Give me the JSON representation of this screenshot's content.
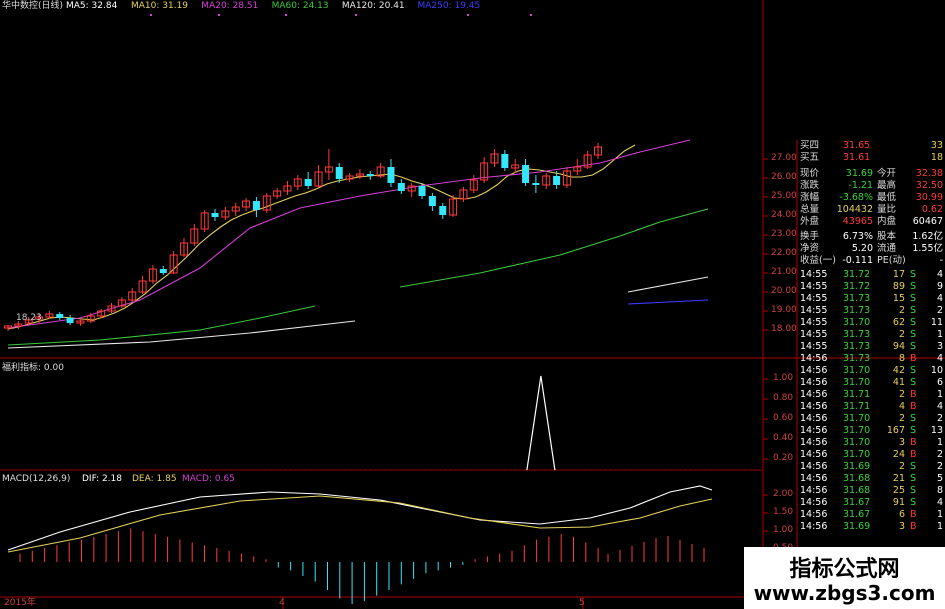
{
  "header": {
    "title": "华中数控(日线)",
    "ma": [
      {
        "label": "MA5: 32.84",
        "color": "#ffffff"
      },
      {
        "label": "MA10: 31.19",
        "color": "#e6d15a"
      },
      {
        "label": "MA20: 28.51",
        "color": "#d43fd4"
      },
      {
        "label": "MA60: 24.13",
        "color": "#3ac83a"
      },
      {
        "label": "MA120: 20.41",
        "color": "#e8e8e8"
      },
      {
        "label": "MA250: 19.45",
        "color": "#3b3bff"
      }
    ]
  },
  "colors": {
    "up": "#ff3b3b",
    "down": "#35e6ff",
    "axis": "#b00000",
    "grid": "#7a0000"
  },
  "price_axis": {
    "labels": [
      "27.00",
      "26.00",
      "25.00",
      "24.00",
      "23.00",
      "22.00",
      "21.00",
      "20.00",
      "19.00",
      "18.00"
    ]
  },
  "indicator": {
    "title": "福利指标: 0.00",
    "axis_labels": [
      "1.00",
      "0.80",
      "0.60",
      "0.40",
      "0.20"
    ]
  },
  "macd": {
    "title": "MACD(12,26,9)",
    "dif": "DIF: 2.18",
    "dea": "DEA: 1.85",
    "macd": "MACD: 0.65",
    "axis_labels": [
      "2.00",
      "1.50",
      "1.00",
      "0.50"
    ]
  },
  "date_axis": {
    "labels": [
      "2015年",
      "4",
      "5"
    ]
  },
  "price_note": "18.23",
  "chart_data": {
    "type": "candlestick",
    "candles": [
      [
        18.35,
        18.45,
        18.2,
        18.5
      ],
      [
        18.45,
        18.55,
        18.3,
        18.7
      ],
      [
        18.6,
        18.75,
        18.5,
        18.9
      ],
      [
        18.8,
        18.9,
        18.6,
        19.1
      ],
      [
        18.9,
        19.05,
        18.8,
        19.2
      ],
      [
        19.05,
        18.85,
        18.75,
        19.15
      ],
      [
        18.85,
        18.6,
        18.5,
        19.0
      ],
      [
        18.6,
        18.7,
        18.45,
        18.85
      ],
      [
        18.7,
        18.95,
        18.6,
        19.1
      ],
      [
        18.95,
        19.2,
        18.85,
        19.3
      ],
      [
        19.2,
        19.45,
        19.1,
        19.6
      ],
      [
        19.45,
        19.75,
        19.35,
        19.9
      ],
      [
        19.75,
        20.15,
        19.65,
        20.35
      ],
      [
        20.15,
        20.7,
        20.05,
        20.95
      ],
      [
        20.7,
        21.3,
        20.55,
        21.5
      ],
      [
        21.3,
        21.1,
        21.0,
        21.45
      ],
      [
        21.1,
        22.0,
        21.05,
        22.2
      ],
      [
        22.0,
        22.6,
        21.9,
        22.85
      ],
      [
        22.6,
        23.3,
        22.45,
        23.55
      ],
      [
        23.3,
        24.1,
        23.15,
        24.25
      ],
      [
        24.1,
        23.9,
        23.7,
        24.3
      ],
      [
        23.9,
        24.2,
        23.75,
        24.4
      ],
      [
        24.2,
        24.4,
        23.95,
        24.6
      ],
      [
        24.4,
        24.7,
        24.2,
        24.85
      ],
      [
        24.7,
        24.25,
        23.9,
        24.9
      ],
      [
        24.25,
        24.95,
        24.1,
        25.1
      ],
      [
        24.95,
        25.2,
        24.8,
        25.35
      ],
      [
        25.2,
        25.45,
        25.0,
        25.7
      ],
      [
        25.45,
        25.8,
        25.25,
        26.0
      ],
      [
        25.8,
        25.45,
        25.3,
        26.15
      ],
      [
        25.45,
        26.15,
        25.35,
        26.5
      ],
      [
        26.15,
        26.4,
        25.75,
        27.3
      ],
      [
        26.4,
        25.8,
        25.6,
        26.6
      ],
      [
        25.8,
        25.95,
        25.65,
        26.1
      ],
      [
        25.95,
        26.05,
        25.8,
        26.3
      ],
      [
        26.05,
        25.95,
        25.75,
        26.2
      ],
      [
        25.95,
        26.4,
        25.85,
        26.6
      ],
      [
        26.4,
        25.6,
        25.4,
        26.8
      ],
      [
        25.6,
        25.2,
        25.05,
        25.8
      ],
      [
        25.2,
        25.45,
        24.9,
        25.6
      ],
      [
        25.45,
        24.95,
        24.8,
        25.6
      ],
      [
        24.95,
        24.45,
        24.2,
        25.1
      ],
      [
        24.45,
        24.0,
        23.8,
        24.6
      ],
      [
        24.0,
        24.8,
        23.9,
        25.0
      ],
      [
        24.8,
        25.25,
        24.65,
        25.4
      ],
      [
        25.25,
        25.75,
        25.1,
        26.0
      ],
      [
        25.75,
        26.6,
        25.6,
        26.9
      ],
      [
        26.6,
        27.05,
        26.4,
        27.3
      ],
      [
        27.05,
        26.35,
        26.2,
        27.25
      ],
      [
        26.35,
        26.5,
        26.1,
        26.8
      ],
      [
        26.5,
        25.6,
        25.45,
        26.8
      ],
      [
        25.6,
        25.5,
        25.1,
        26.0
      ],
      [
        25.5,
        25.95,
        25.3,
        26.1
      ],
      [
        25.95,
        25.5,
        25.3,
        26.2
      ],
      [
        25.5,
        26.2,
        25.35,
        26.4
      ],
      [
        26.2,
        26.4,
        26.0,
        26.8
      ],
      [
        26.4,
        27.0,
        26.3,
        27.2
      ],
      [
        27.0,
        27.4,
        26.8,
        27.6
      ]
    ],
    "dates_shown": [
      "2015年",
      "4",
      "5"
    ],
    "ma_lines": {
      "MA5": [
        18.3,
        18.4,
        18.55,
        18.7,
        18.85,
        18.9,
        18.85,
        18.8,
        18.75,
        18.9,
        19.1,
        19.35,
        19.7,
        20.1,
        20.6,
        21.0,
        21.5,
        22.0,
        22.55,
        23.0,
        23.4,
        23.75,
        24.0,
        24.2,
        24.35,
        24.55,
        24.75,
        24.95,
        25.1,
        25.3,
        25.55,
        25.7,
        25.8,
        25.9,
        25.95,
        26.0,
        26.05,
        25.9,
        25.7,
        25.55,
        25.35,
        25.1,
        24.85,
        24.8,
        24.9,
        25.15,
        25.5,
        25.95,
        26.2,
        26.3,
        26.25,
        26.15,
        26.05,
        25.9,
        25.9,
        26.0,
        26.3,
        26.75,
        27.2,
        27.5
      ]
    },
    "price_range": [
      17.5,
      28.0
    ],
    "indicator": {
      "title": "福利指标",
      "value": 0.0,
      "spike_index": 51,
      "spike_value": 1.0
    },
    "macd": {
      "dif": 2.18,
      "dea": 1.85,
      "macd": 0.65
    }
  },
  "quote": {
    "levels": [
      {
        "label": "买四",
        "price": "31.65",
        "vol": "33"
      },
      {
        "label": "买五",
        "price": "31.61",
        "vol": "18"
      }
    ],
    "stats": [
      {
        "l1": "现价",
        "v1": "31.69",
        "l2": "今开",
        "v2": "32.38",
        "c1": "#3ad43a"
      },
      {
        "l1": "涨跌",
        "v1": "-1.21",
        "l2": "最高",
        "v2": "32.50",
        "c1": "#3ad43a"
      },
      {
        "l1": "涨幅",
        "v1": "-3.68%",
        "l2": "最低",
        "v2": "30.99",
        "c1": "#3ad43a"
      },
      {
        "l1": "总量",
        "v1": "104432",
        "l2": "量比",
        "v2": "0.62",
        "c1": "#e6d15a"
      },
      {
        "l1": "外盘",
        "v1": "43965",
        "l2": "内盘",
        "v2": "60467",
        "c1": "#ff3b3b"
      },
      {
        "l1": "换手",
        "v1": "6.73%",
        "l2": "股本",
        "v2": "1.62亿",
        "c1": "#ffffff"
      },
      {
        "l1": "净资",
        "v1": "5.20",
        "l2": "流通",
        "v2": "1.55亿",
        "c1": "#ffffff"
      },
      {
        "l1": "收益(一)",
        "v1": "-0.111",
        "l2": "PE(动)",
        "v2": "-",
        "c1": "#ffffff"
      }
    ],
    "ticks": [
      {
        "t": "14:55",
        "p": "31.72",
        "v": "17",
        "s": "S",
        "n": "4"
      },
      {
        "t": "14:55",
        "p": "31.72",
        "v": "89",
        "s": "S",
        "n": "9"
      },
      {
        "t": "14:55",
        "p": "31.73",
        "v": "15",
        "s": "S",
        "n": "4"
      },
      {
        "t": "14:55",
        "p": "31.73",
        "v": "2",
        "s": "S",
        "n": "2"
      },
      {
        "t": "14:55",
        "p": "31.70",
        "v": "62",
        "s": "S",
        "n": "11"
      },
      {
        "t": "14:55",
        "p": "31.73",
        "v": "2",
        "s": "S",
        "n": "1"
      },
      {
        "t": "14:55",
        "p": "31.73",
        "v": "94",
        "s": "S",
        "n": "3"
      },
      {
        "t": "14:56",
        "p": "31.73",
        "v": "8",
        "s": "B",
        "n": "4"
      },
      {
        "t": "14:56",
        "p": "31.70",
        "v": "42",
        "s": "S",
        "n": "10"
      },
      {
        "t": "14:56",
        "p": "31.70",
        "v": "41",
        "s": "S",
        "n": "6"
      },
      {
        "t": "14:56",
        "p": "31.71",
        "v": "2",
        "s": "B",
        "n": "1"
      },
      {
        "t": "14:56",
        "p": "31.71",
        "v": "4",
        "s": "B",
        "n": "4"
      },
      {
        "t": "14:56",
        "p": "31.70",
        "v": "2",
        "s": "S",
        "n": "2"
      },
      {
        "t": "14:56",
        "p": "31.70",
        "v": "167",
        "s": "S",
        "n": "13"
      },
      {
        "t": "14:56",
        "p": "31.70",
        "v": "3",
        "s": "B",
        "n": "1"
      },
      {
        "t": "14:56",
        "p": "31.70",
        "v": "24",
        "s": "B",
        "n": "2"
      },
      {
        "t": "14:56",
        "p": "31.69",
        "v": "2",
        "s": "S",
        "n": "2"
      },
      {
        "t": "14:56",
        "p": "31.68",
        "v": "21",
        "s": "S",
        "n": "5"
      },
      {
        "t": "14:56",
        "p": "31.68",
        "v": "25",
        "s": "S",
        "n": "8"
      },
      {
        "t": "14:56",
        "p": "31.67",
        "v": "91",
        "s": "S",
        "n": "4"
      },
      {
        "t": "14:56",
        "p": "31.67",
        "v": "6",
        "s": "B",
        "n": "1"
      },
      {
        "t": "14:56",
        "p": "31.69",
        "v": "3",
        "s": "B",
        "n": "1"
      }
    ]
  },
  "watermark": {
    "line1": "指标公式网",
    "line2": "www.zbgs3.com"
  }
}
